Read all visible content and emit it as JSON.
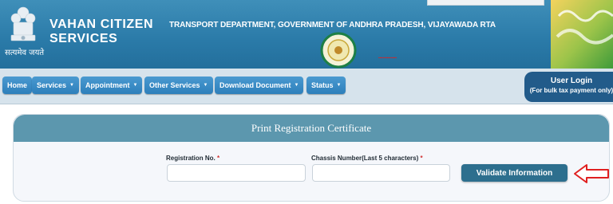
{
  "header": {
    "brand_line1": "VAHAN CITIZEN",
    "brand_line2": "SERVICES",
    "emblem_caption": "सत्यमेव जयते",
    "department": "TRANSPORT DEPARTMENT, GOVERNMENT OF ANDHRA PRADESH, VIJAYAWADA RTA"
  },
  "nav": {
    "items": [
      {
        "label": "Home",
        "dropdown": false
      },
      {
        "label": "Services",
        "dropdown": true
      },
      {
        "label": "Appointment",
        "dropdown": true
      },
      {
        "label": "Other Services",
        "dropdown": true
      },
      {
        "label": "Download Document",
        "dropdown": true
      },
      {
        "label": "Status",
        "dropdown": true
      }
    ],
    "user_login": {
      "title": "User Login",
      "subtitle": "(For bulk tax payment only)"
    }
  },
  "panel": {
    "title": "Print Registration Certificate",
    "fields": [
      {
        "label": "Registration No.",
        "required": "*",
        "value": ""
      },
      {
        "label": "Chassis Number(Last 5 characters)",
        "required": "*",
        "value": ""
      }
    ],
    "validate_label": "Validate Information"
  },
  "colors": {
    "header_blue": "#2a7aa8",
    "nav_button": "#3b8dc7",
    "panel_header": "#5c97ae",
    "validate_button": "#2d6f8e",
    "arrow_red": "#e02020"
  }
}
